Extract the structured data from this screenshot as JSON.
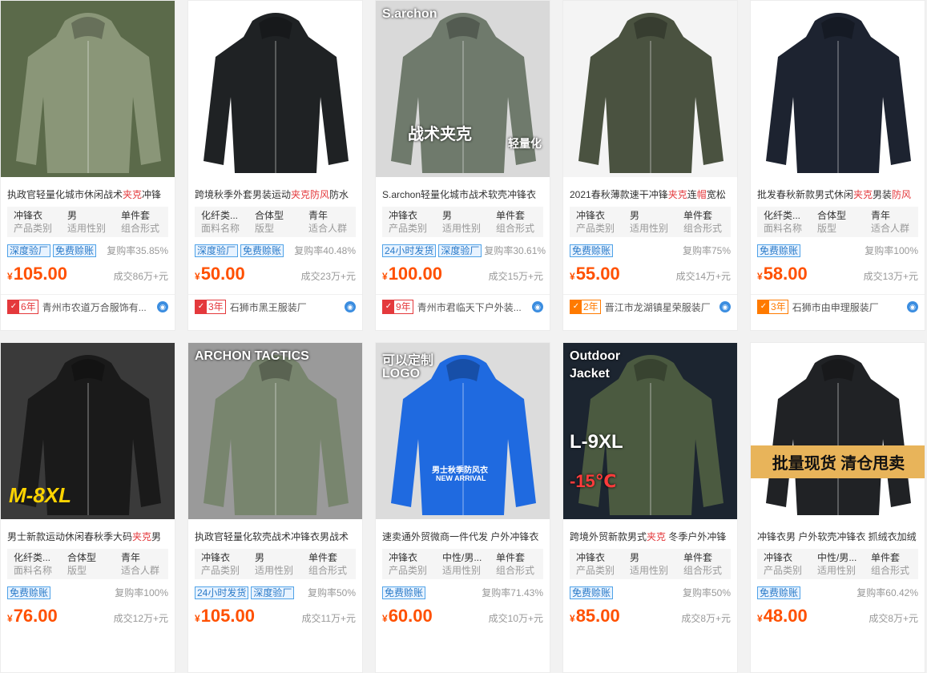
{
  "products": [
    {
      "title_parts": [
        [
          "执政官轻量化城市休闲战术",
          false
        ],
        [
          "夹克",
          true
        ],
        [
          "冲锋",
          false
        ]
      ],
      "attrs": [
        {
          "v": "冲锋衣",
          "k": "产品类别"
        },
        {
          "v": "男",
          "k": "适用性别"
        },
        {
          "v": "单件套",
          "k": "组合形式"
        }
      ],
      "tags": [
        "深度验厂",
        "免费赊账"
      ],
      "rebuy": "复购率35.85%",
      "price": "105.00",
      "deal": "成交86万+元",
      "years": "6年",
      "years_color": "red",
      "shop": "青州市农道万合服饰有...",
      "img": {
        "bg": "#5b6a4a",
        "jacket": "#8a9678",
        "overlay": ""
      }
    },
    {
      "title_parts": [
        [
          "跨境秋季外套男装运动",
          false
        ],
        [
          "夹克防风",
          true
        ],
        [
          "防水",
          false
        ]
      ],
      "attrs": [
        {
          "v": "化纤类...",
          "k": "面料名称"
        },
        {
          "v": "合体型",
          "k": "版型"
        },
        {
          "v": "青年",
          "k": "适合人群"
        }
      ],
      "tags": [
        "深度验厂",
        "免费赊账"
      ],
      "rebuy": "复购率40.48%",
      "price": "50.00",
      "deal": "成交23万+元",
      "years": "3年",
      "years_color": "red",
      "shop": "石狮市黑王服装厂",
      "img": {
        "bg": "#ffffff",
        "jacket": "#1f2224",
        "overlay": ""
      }
    },
    {
      "title_parts": [
        [
          "S.archon轻量化城市战术软壳冲锋衣",
          false
        ]
      ],
      "attrs": [
        {
          "v": "冲锋衣",
          "k": "产品类别"
        },
        {
          "v": "男",
          "k": "适用性别"
        },
        {
          "v": "单件套",
          "k": "组合形式"
        }
      ],
      "tags": [
        "24小时发货",
        "深度验厂"
      ],
      "rebuy": "复购率30.61%",
      "price": "100.00",
      "deal": "成交15万+元",
      "years": "9年",
      "years_color": "red",
      "shop": "青州市君临天下户外装...",
      "img": {
        "bg": "#d9d9d9",
        "jacket": "#6f7a6c",
        "overlay": "S.archon",
        "banner": "战术夹克",
        "banner2": "轻量化"
      }
    },
    {
      "title_parts": [
        [
          "2021春秋薄款速干冲锋",
          false
        ],
        [
          "夹克",
          true
        ],
        [
          "连",
          false
        ],
        [
          "帽",
          true
        ],
        [
          "宽松",
          false
        ]
      ],
      "attrs": [
        {
          "v": "冲锋衣",
          "k": "产品类别"
        },
        {
          "v": "男",
          "k": "适用性别"
        },
        {
          "v": "单件套",
          "k": "组合形式"
        }
      ],
      "tags": [
        "免费赊账"
      ],
      "rebuy": "复购率75%",
      "price": "55.00",
      "deal": "成交14万+元",
      "years": "2年",
      "years_color": "orange",
      "shop": "晋江市龙湖镇星荣服装厂",
      "img": {
        "bg": "#f4f4f4",
        "jacket": "#4a5240",
        "overlay": ""
      }
    },
    {
      "title_parts": [
        [
          "批发春秋新款男式休闲",
          false
        ],
        [
          "夹克",
          true
        ],
        [
          "男装",
          false
        ],
        [
          "防风",
          true
        ]
      ],
      "attrs": [
        {
          "v": "化纤类...",
          "k": "面料名称"
        },
        {
          "v": "合体型",
          "k": "版型"
        },
        {
          "v": "青年",
          "k": "适合人群"
        }
      ],
      "tags": [
        "免费赊账"
      ],
      "rebuy": "复购率100%",
      "price": "58.00",
      "deal": "成交13万+元",
      "years": "3年",
      "years_color": "orange",
      "shop": "石狮市由申理服装厂",
      "img": {
        "bg": "#ffffff",
        "jacket": "#1d2330",
        "overlay": ""
      }
    },
    {
      "title_parts": [
        [
          "男士新款运动休闲春秋季大码",
          false
        ],
        [
          "夹克",
          true
        ],
        [
          "男",
          false
        ]
      ],
      "attrs": [
        {
          "v": "化纤类...",
          "k": "面料名称"
        },
        {
          "v": "合体型",
          "k": "版型"
        },
        {
          "v": "青年",
          "k": "适合人群"
        }
      ],
      "tags": [
        "免费赊账"
      ],
      "rebuy": "复购率100%",
      "price": "76.00",
      "deal": "成交12万+元",
      "img": {
        "bg": "#3a3a3a",
        "jacket": "#1a1a1a",
        "overlay": "M-8XL"
      }
    },
    {
      "title_parts": [
        [
          "执政官轻量化软壳战术冲锋衣男战术",
          false
        ]
      ],
      "attrs": [
        {
          "v": "冲锋衣",
          "k": "产品类别"
        },
        {
          "v": "男",
          "k": "适用性别"
        },
        {
          "v": "单件套",
          "k": "组合形式"
        }
      ],
      "tags": [
        "24小时发货",
        "深度验厂"
      ],
      "rebuy": "复购率50%",
      "price": "105.00",
      "deal": "成交11万+元",
      "img": {
        "bg": "#9a9a9a",
        "jacket": "#78856e",
        "overlay": "ARCHON TACTICS"
      }
    },
    {
      "title_parts": [
        [
          "速卖通外贸微商一件代发 户外冲锋衣",
          false
        ]
      ],
      "attrs": [
        {
          "v": "冲锋衣",
          "k": "产品类别"
        },
        {
          "v": "中性/男...",
          "k": "适用性别"
        },
        {
          "v": "单件套",
          "k": "组合形式"
        }
      ],
      "tags": [
        "免费赊账"
      ],
      "rebuy": "复购率71.43%",
      "price": "60.00",
      "deal": "成交10万+元",
      "img": {
        "bg": "#dcdcdc",
        "jacket": "#1f6ae0",
        "overlay": "可以定制",
        "overlay2": "LOGO",
        "label": "男士秋季防风衣",
        "label2": "NEW ARRIVAL"
      }
    },
    {
      "title_parts": [
        [
          "跨境外贸新款男式",
          false
        ],
        [
          "夹克",
          true
        ],
        [
          " 冬季户外冲锋",
          false
        ]
      ],
      "attrs": [
        {
          "v": "冲锋衣",
          "k": "产品类别"
        },
        {
          "v": "男",
          "k": "适用性别"
        },
        {
          "v": "单件套",
          "k": "组合形式"
        }
      ],
      "tags": [
        "免费赊账"
      ],
      "rebuy": "复购率50%",
      "price": "85.00",
      "deal": "成交8万+元",
      "img": {
        "bg": "#1c2530",
        "jacket": "#4b5a40",
        "overlay": "Outdoor",
        "overlay2": "Jacket",
        "overlay3": "L-9XL",
        "overlay4": "-15℃"
      }
    },
    {
      "title_parts": [
        [
          "冲锋衣男 户外软壳冲锋衣 抓绒衣加绒",
          false
        ]
      ],
      "attrs": [
        {
          "v": "冲锋衣",
          "k": "产品类别"
        },
        {
          "v": "中性/男...",
          "k": "适用性别"
        },
        {
          "v": "单件套",
          "k": "组合形式"
        }
      ],
      "tags": [
        "免费赊账"
      ],
      "rebuy": "复购率60.42%",
      "price": "48.00",
      "deal": "成交8万+元",
      "img": {
        "bg": "#ffffff",
        "jacket": "#202225",
        "overlay": "批量现货 清仓甩卖"
      }
    }
  ],
  "currency": "¥"
}
